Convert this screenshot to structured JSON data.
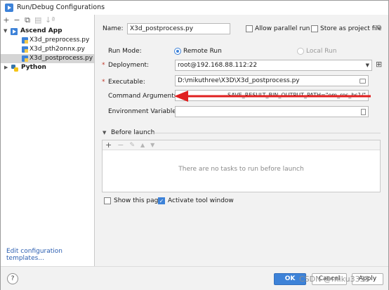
{
  "window": {
    "title": "Run/Debug Configurations"
  },
  "left_toolbar": [
    "+",
    "−",
    "⧉",
    "▤",
    "↓ª"
  ],
  "tree": {
    "group_ascend": "Ascend App",
    "items": [
      "X3d_preprocess.py",
      "X3d_pth2onnx.py",
      "X3d_postprocess.py"
    ],
    "group_python": "Python"
  },
  "edit_templates": "Edit configuration templates...",
  "form": {
    "name_label": "Name:",
    "name_value": "X3d_postprocess.py",
    "allow_parallel": "Allow parallel run",
    "store_as_project": "Store as project file",
    "run_mode_label": "Run Mode:",
    "remote_run": "Remote Run",
    "local_run": "Local Run",
    "deployment_label": "Deployment:",
    "deployment_value": "root@192.168.88.112:22",
    "executable_label": "Executable:",
    "executable_value": "D:\\mikuthree\\X3D\\X3d_postprocess.py",
    "command_args_label": "Command Arguments:",
    "command_args_value": "--SAVE_RESULT_BIN_OUTPUT_PATH=\"om_res_bs1/\"",
    "env_vars_label": "Environment Variables:"
  },
  "before_launch": {
    "title": "Before launch",
    "empty_text": "There are no tasks to run before launch"
  },
  "show_this_page": "Show this page",
  "activate_tool_window": "Activate tool window",
  "buttons": {
    "help": "?",
    "ok": "OK",
    "cancel": "Cancel",
    "apply": "Apply"
  },
  "watermark": "CSDN @miku3333",
  "colors": {
    "accent": "#3d82d8",
    "arrow": "#e02020"
  }
}
